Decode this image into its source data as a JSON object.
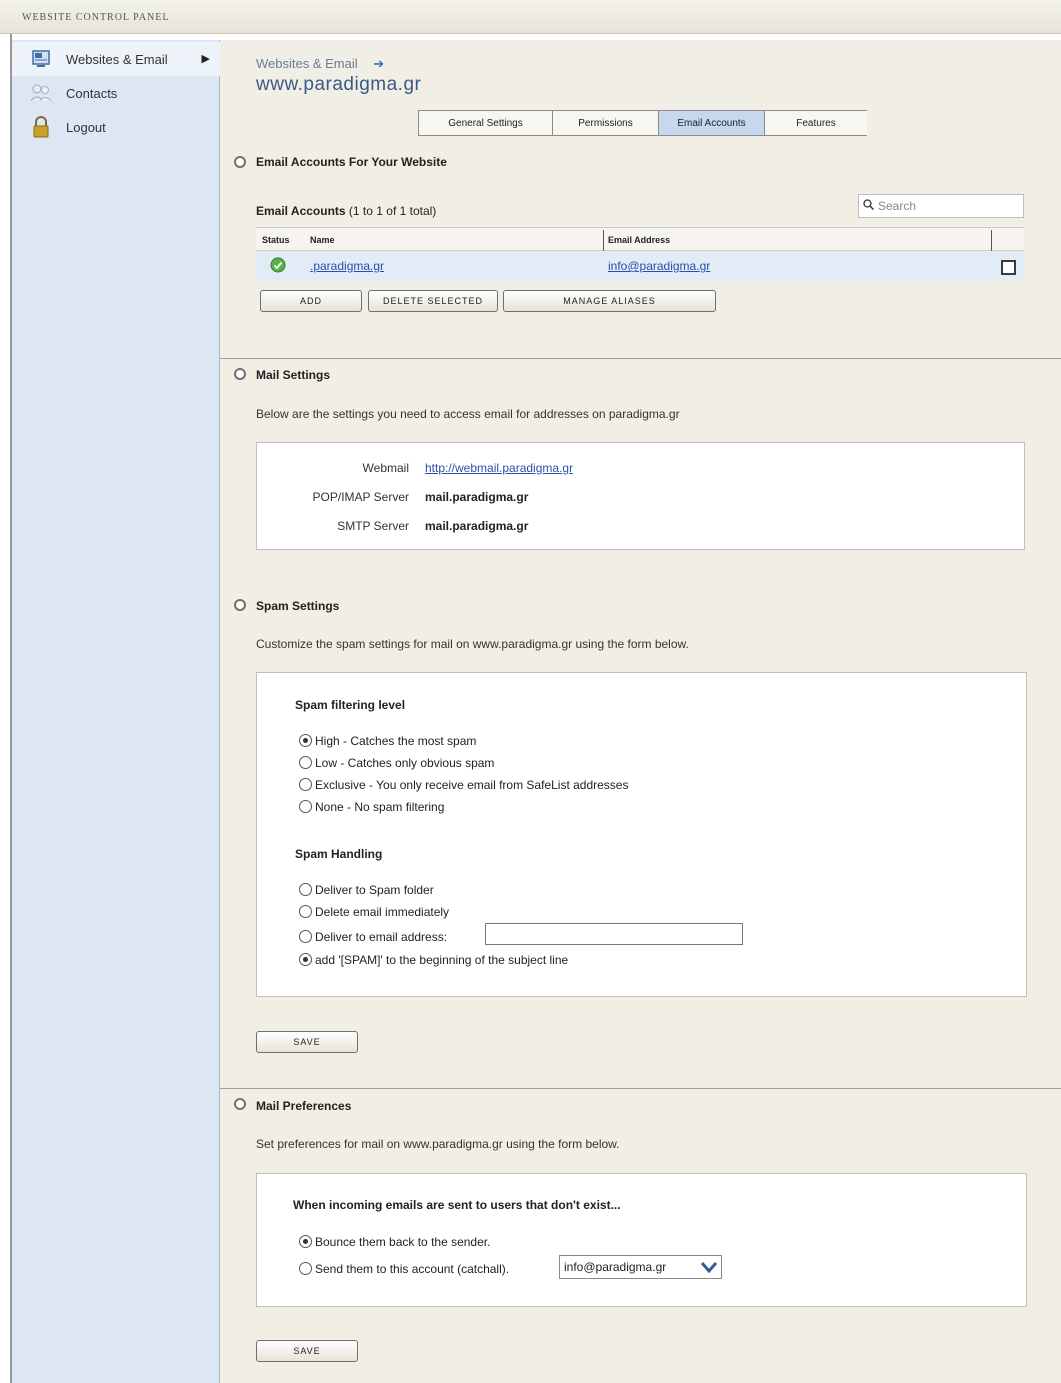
{
  "window": {
    "title": "WEBSITE CONTROL PANEL"
  },
  "sidebar": {
    "items": [
      {
        "label": "Websites & Email",
        "icon": "websites-icon"
      },
      {
        "label": "Contacts",
        "icon": "contacts-icon"
      },
      {
        "label": "Logout",
        "icon": "lock-icon"
      }
    ]
  },
  "header": {
    "breadcrumb": "Websites & Email",
    "breadcrumb_arrow": "➔",
    "domain": "www.paradigma.gr"
  },
  "tabs": [
    {
      "label": "General Settings"
    },
    {
      "label": "Permissions"
    },
    {
      "label": "Email Accounts"
    },
    {
      "label": "Features"
    }
  ],
  "email_accounts": {
    "section_title": "Email Accounts For Your Website",
    "list_label": "Email Accounts",
    "count_text": "(1 to 1 of 1 total)",
    "search_placeholder": "Search",
    "columns": {
      "status": "Status",
      "name": "Name",
      "email": "Email Address"
    },
    "rows": [
      {
        "name": ".paradigma.gr",
        "email": "info@paradigma.gr"
      }
    ],
    "buttons": {
      "add": "ADD",
      "delete": "DELETE SELECTED",
      "aliases": "MANAGE ALIASES"
    }
  },
  "mail_settings": {
    "section_title": "Mail Settings",
    "description": "Below are the settings you need to access email for addresses on paradigma.gr",
    "webmail_label": "Webmail",
    "webmail_value": "http://webmail.paradigma.gr",
    "pop_label": "POP/IMAP Server",
    "pop_value": "mail.paradigma.gr",
    "smtp_label": "SMTP Server",
    "smtp_value": "mail.paradigma.gr"
  },
  "spam_settings": {
    "section_title": "Spam Settings",
    "description": "Customize the spam settings for mail on www.paradigma.gr using the form below.",
    "filter_title": "Spam filtering level",
    "filter_options": [
      "High - Catches the most spam",
      "Low - Catches only obvious spam",
      "Exclusive - You only receive email from SafeList addresses",
      "None - No spam filtering"
    ],
    "filter_selected": 0,
    "handling_title": "Spam Handling",
    "handling_options": [
      "Deliver to Spam folder",
      "Delete email immediately",
      "Deliver to email address:",
      "add '[SPAM]' to the beginning of the subject line"
    ],
    "handling_selected": 3,
    "deliver_address_value": "",
    "save_label": "SAVE"
  },
  "mail_preferences": {
    "section_title": "Mail Preferences",
    "description": "Set preferences for mail on www.paradigma.gr using the form below.",
    "question": "When incoming emails are sent to users that don't exist...",
    "options": [
      "Bounce them back to the sender.",
      "Send them to this account (catchall)."
    ],
    "selected": 0,
    "catchall_account": "info@paradigma.gr",
    "save_label": "SAVE"
  },
  "colors": {
    "sidebar_bg": "#dde7f3",
    "main_bg": "#f0eee5",
    "active_tab": "#c6d7ee",
    "link": "#2b4fa8",
    "title": "#3a5a84"
  }
}
